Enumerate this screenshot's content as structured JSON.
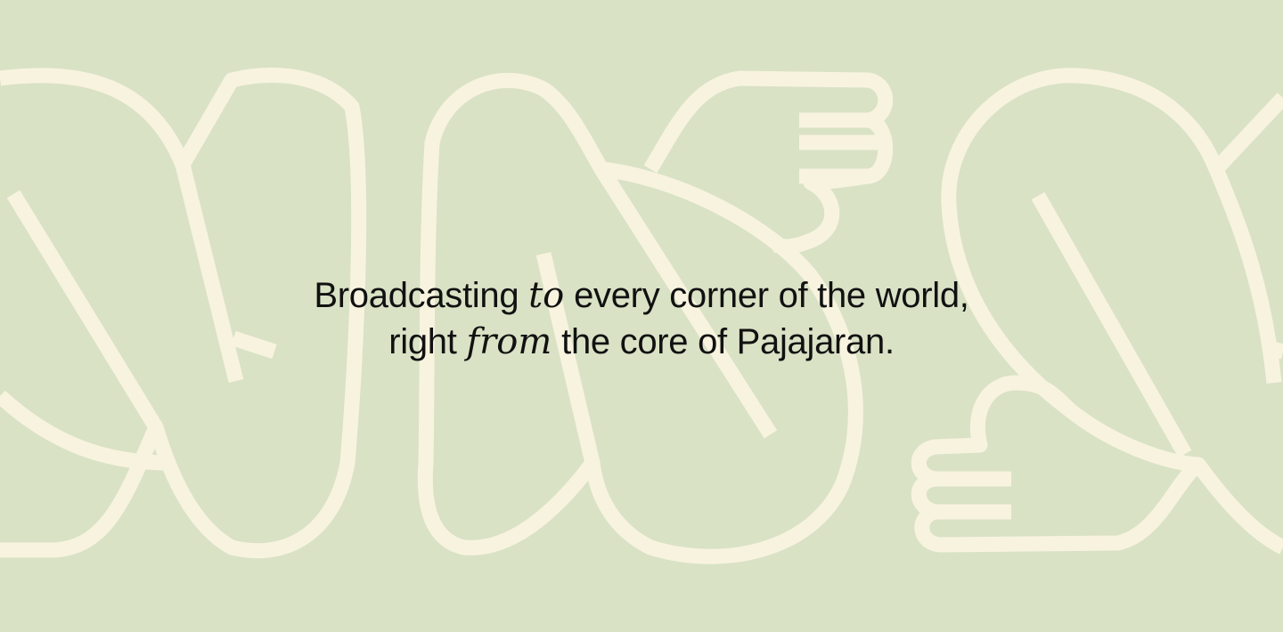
{
  "theme": {
    "background": "#d9e2c5",
    "art_stroke": "#f8f3df",
    "text": "#111111"
  },
  "decoration": {
    "icon": "outlined-hand-gesture-shapes"
  },
  "tagline": {
    "line1": {
      "before": "Broadcasting ",
      "emphasis": "to",
      "after": " every corner of the world,"
    },
    "line2": {
      "before": "right ",
      "emphasis": "from",
      "after": " the core of Pajajaran."
    }
  }
}
